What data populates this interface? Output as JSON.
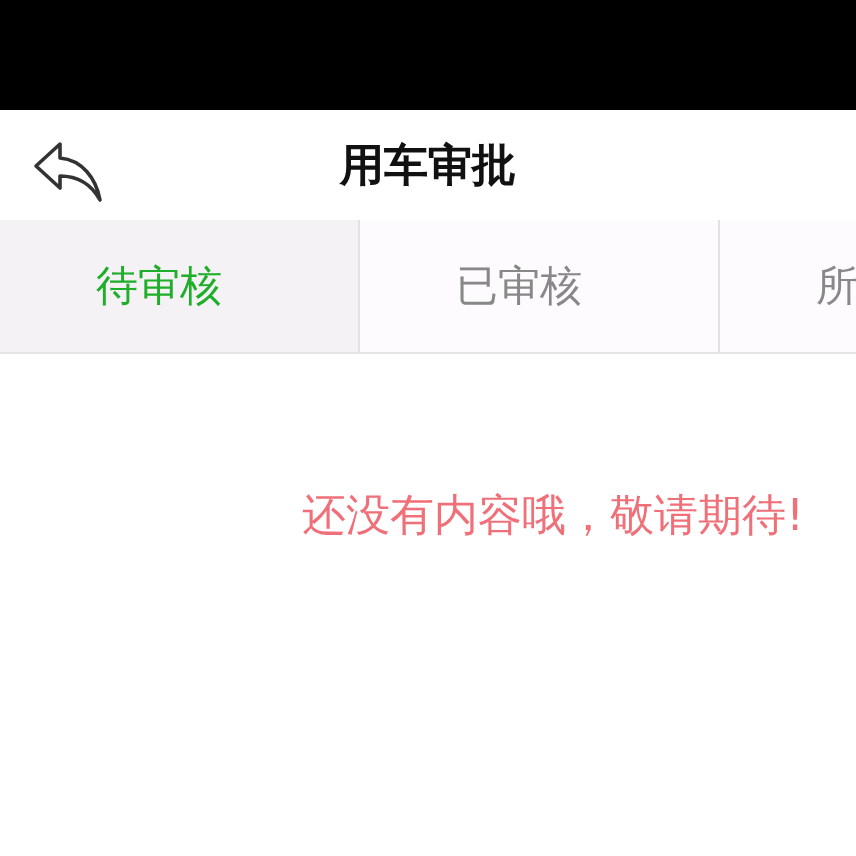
{
  "header": {
    "title": "用车审批"
  },
  "tabs": [
    {
      "label": "待审核",
      "selected": true
    },
    {
      "label": "已审核",
      "selected": false
    },
    {
      "label": "所",
      "selected": false
    }
  ],
  "empty_message": "还没有内容哦，敬请期待!"
}
